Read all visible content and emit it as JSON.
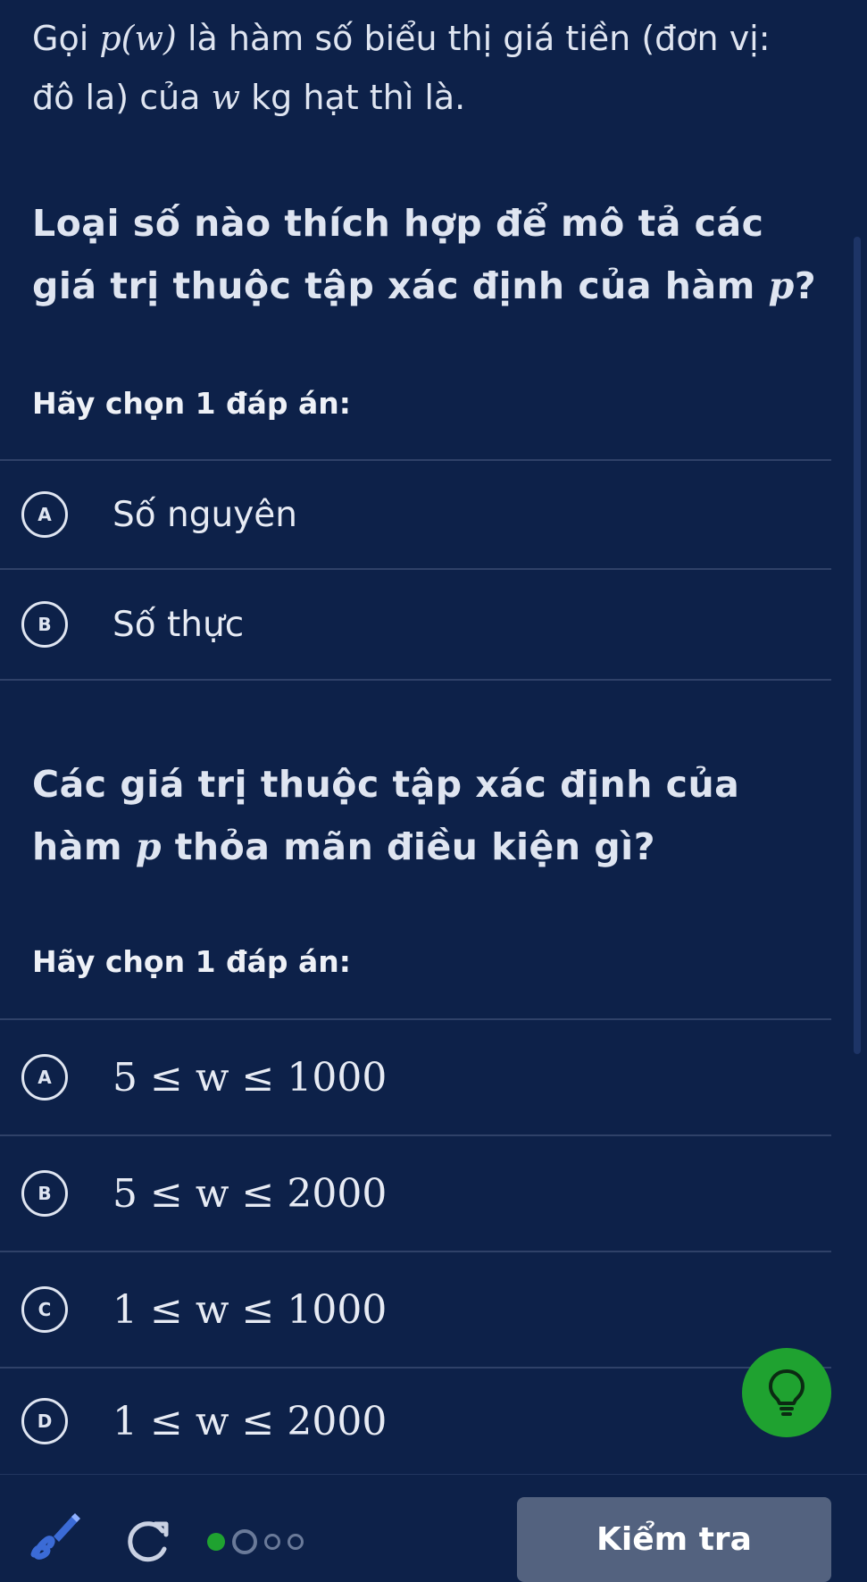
{
  "intro": {
    "line1_pre": "Gọi ",
    "line1_math": "p(w)",
    "line1_post": " là hàm số biểu thị giá tiền (đơn vị:",
    "line2_pre": "đô la) của ",
    "line2_math": "w",
    "line2_post": " kg hạt thì là."
  },
  "question1": {
    "text_pre": "Loại số nào thích hợp để mô tả các giá trị thuộc tập xác định của hàm ",
    "text_math": "p",
    "text_post": "?",
    "prompt": "Hãy chọn 1 đáp án:",
    "choices": [
      {
        "letter": "A",
        "label": "Số nguyên"
      },
      {
        "letter": "B",
        "label": "Số thực"
      }
    ]
  },
  "question2": {
    "text_pre": "Các giá trị thuộc tập xác định của hàm ",
    "text_math": "p",
    "text_post": " thỏa mãn điều kiện gì?",
    "prompt": "Hãy chọn 1 đáp án:",
    "choices": [
      {
        "letter": "A",
        "label": "5 ≤ w ≤ 1000"
      },
      {
        "letter": "B",
        "label": "5 ≤ w ≤ 2000"
      },
      {
        "letter": "C",
        "label": "1 ≤ w ≤ 1000"
      },
      {
        "letter": "D",
        "label": "1 ≤ w ≤ 2000"
      }
    ]
  },
  "footer": {
    "check_label": "Kiểm tra",
    "hint_icon": "lightbulb-icon",
    "scratchpad_icon": "scratchpad-pencil-icon",
    "refresh_icon": "refresh-icon",
    "progress_steps_total": 4,
    "progress_steps_done": 1
  },
  "colors": {
    "background": "#0d2149",
    "hint_green": "#1fa230",
    "check_button": "#53627f",
    "progress_green": "#1fa230",
    "scratch_blue": "#3b6bd6"
  }
}
